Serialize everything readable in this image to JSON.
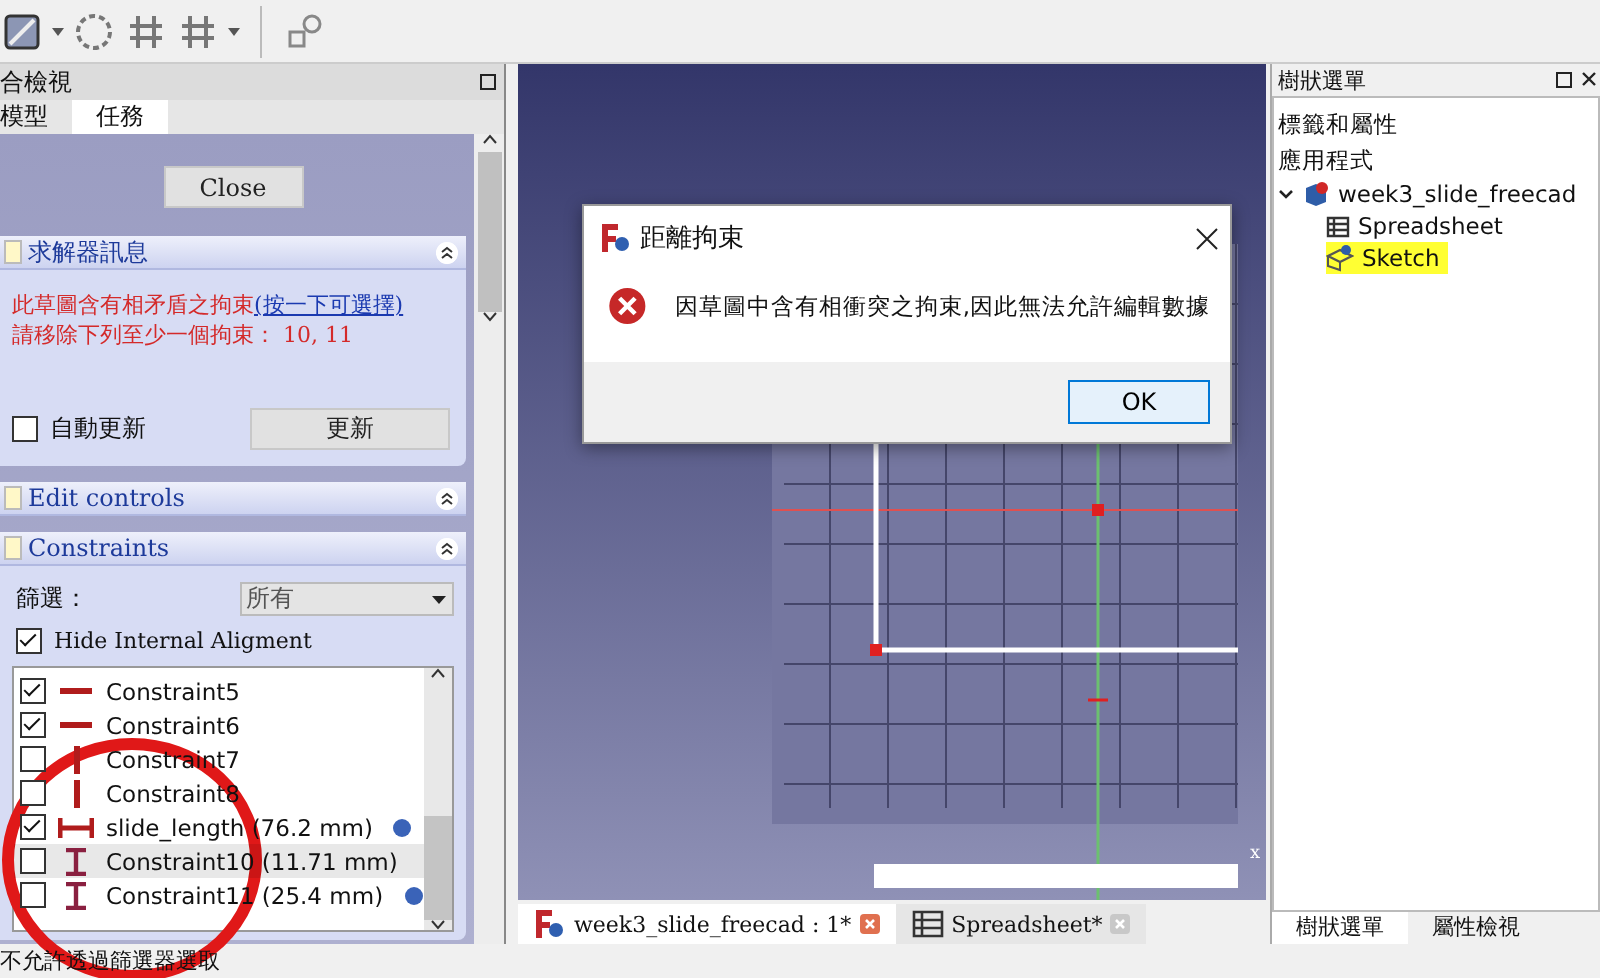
{
  "left_panel": {
    "title": "合檢視",
    "tabs": [
      {
        "label": "模型",
        "selected": false
      },
      {
        "label": "任務",
        "selected": true
      }
    ],
    "close_button": "Close",
    "solver": {
      "title": "求解器訊息",
      "message": "此草圖含有相矛盾之拘束",
      "link": "(按一下可選擇)",
      "detail": "請移除下列至少一個拘束： 10, 11",
      "auto_update": {
        "label": "自動更新",
        "checked": false
      },
      "update_button": "更新"
    },
    "edit_controls": {
      "title": "Edit controls"
    },
    "constraints": {
      "title": "Constraints",
      "filter_label": "篩選：",
      "filter_value": "所有",
      "hide_internal": {
        "label": "Hide Internal Aligment",
        "checked": true
      },
      "items": [
        {
          "name": "Constraint5",
          "kind": "horizontal",
          "checked": true,
          "selected": false,
          "expression": false
        },
        {
          "name": "Constraint6",
          "kind": "horizontal",
          "checked": true,
          "selected": false,
          "expression": false
        },
        {
          "name": "Constraint7",
          "kind": "vertical",
          "checked": false,
          "selected": false,
          "expression": false
        },
        {
          "name": "Constraint8",
          "kind": "vertical",
          "checked": false,
          "selected": false,
          "expression": false
        },
        {
          "name": "slide_length (76.2 mm)",
          "kind": "hdistance",
          "checked": true,
          "selected": false,
          "expression": true
        },
        {
          "name": "Constraint10 (11.71 mm)",
          "kind": "vdistance",
          "checked": false,
          "selected": true,
          "expression": false
        },
        {
          "name": "Constraint11 (25.4 mm)",
          "kind": "vdistance",
          "checked": false,
          "selected": false,
          "expression": true
        }
      ]
    }
  },
  "dialog": {
    "title": "距離拘束",
    "message": "因草圖中含有相衝突之拘束,因此無法允許編輯數據",
    "ok_button": "OK"
  },
  "viewport": {
    "axis_label": "x"
  },
  "document_tabs": [
    {
      "label": "week3_slide_freecad : 1*",
      "kind": "document",
      "selected": true
    },
    {
      "label": "Spreadsheet*",
      "kind": "spreadsheet",
      "selected": false
    }
  ],
  "tree_panel": {
    "title": "樹狀選單",
    "header_label": "標籤和屬性",
    "section": "應用程式",
    "tree": [
      {
        "label": "week3_slide_freecad",
        "kind": "document",
        "expanded": true,
        "selected": false,
        "children": [
          {
            "label": "Spreadsheet",
            "kind": "spreadsheet",
            "selected": false
          },
          {
            "label": "Sketch",
            "kind": "sketch",
            "selected": true
          }
        ]
      }
    ],
    "tabs": [
      {
        "label": "樹狀選單",
        "selected": true
      },
      {
        "label": "屬性檢視",
        "selected": false
      }
    ]
  },
  "status_bar": {
    "text": "不允許透過篩選器選取"
  }
}
